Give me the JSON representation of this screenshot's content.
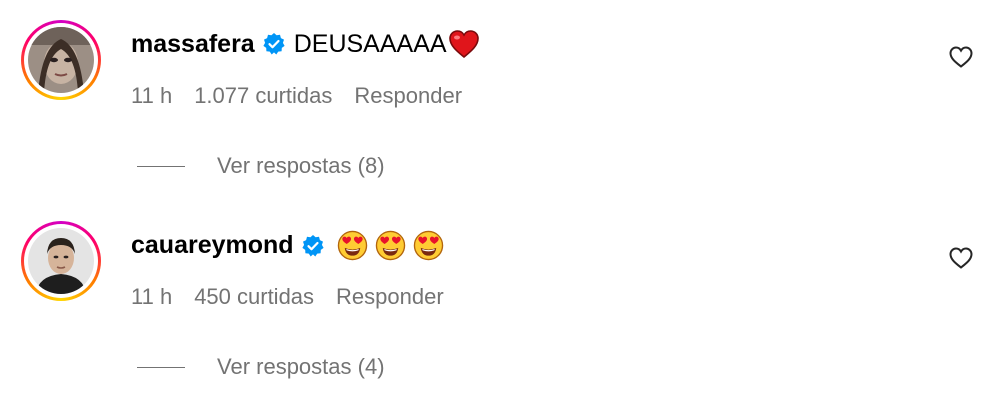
{
  "comments": [
    {
      "username": "massafera",
      "text": "DEUSAAAAA",
      "emoji": "heart",
      "time": "11 h",
      "likes": "1.077 curtidas",
      "reply_label": "Responder",
      "view_replies": "Ver respostas (8)"
    },
    {
      "username": "cauareymond",
      "text": "",
      "emoji": "heart-eyes-x3",
      "time": "11 h",
      "likes": "450 curtidas",
      "reply_label": "Responder",
      "view_replies": "Ver respostas (4)"
    }
  ],
  "colors": {
    "verified": "#0095f6",
    "meta_text": "#737373",
    "heart_emoji": "#e0151b",
    "story_ring": [
      "#d300c5",
      "#ff0069",
      "#ff7a00",
      "#ffd600"
    ]
  },
  "icons": [
    "verified-badge-icon",
    "heart-outline-icon",
    "red-heart-emoji",
    "heart-eyes-emoji"
  ]
}
